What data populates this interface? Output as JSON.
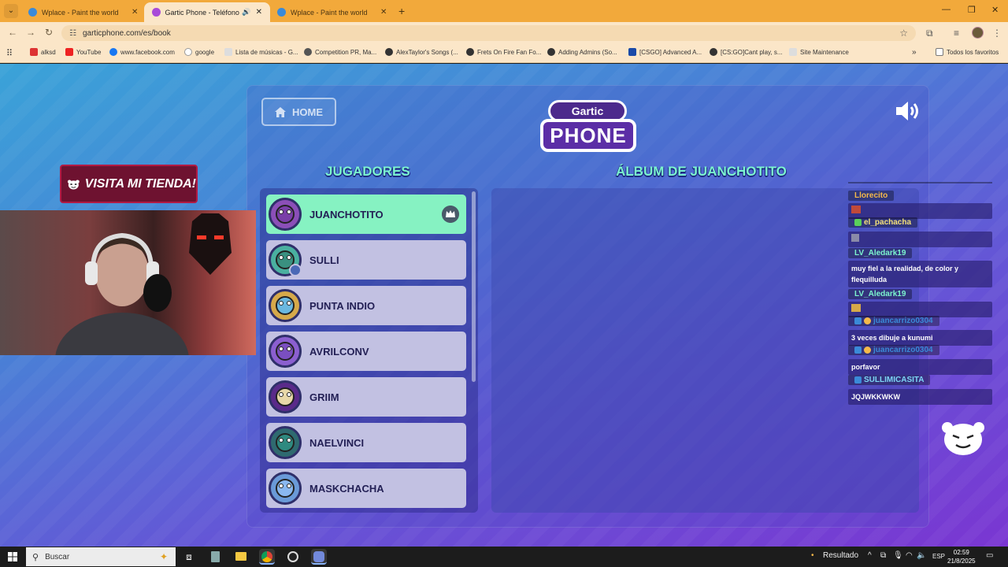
{
  "browser": {
    "tabs": [
      {
        "title": "Wplace - Paint the world",
        "active": false
      },
      {
        "title": "Gartic Phone - Teléfono Del",
        "active": true
      },
      {
        "title": "Wplace - Paint the world",
        "active": false
      }
    ],
    "url": "garticphone.com/es/book",
    "bookmarks": [
      "alksd",
      "YouTube",
      "www.facebook.com",
      "google",
      "Lista de músicas - G...",
      "Competition PR, Ma...",
      "AlexTaylor's Songs (...",
      "Frets On Fire Fan Fo...",
      "Adding Admins (So...",
      "[CSGO] Advanced A...",
      "[CS:GO]Cant play, s...",
      "Site Maintenance"
    ],
    "all_bookmarks": "Todos los favoritos"
  },
  "game": {
    "home_label": "HOME",
    "logo_top": "Gartic",
    "logo_bottom": "PHONE",
    "players_title": "JUGADORES",
    "album_title": "ÁLBUM DE JUANCHOTITO",
    "players": [
      {
        "name": "JUANCHOTITO",
        "host": true,
        "color": "#8b4fb8"
      },
      {
        "name": "SULLI",
        "host": false,
        "color": "#4ab0a0"
      },
      {
        "name": "PUNTA INDIO",
        "host": false,
        "color": "#d6a94a"
      },
      {
        "name": "AVRILCONV",
        "host": false,
        "color": "#8b5fd0"
      },
      {
        "name": "GRIIM",
        "host": false,
        "color": "#c9a050"
      },
      {
        "name": "NAELVINCI",
        "host": false,
        "color": "#2f8a80"
      },
      {
        "name": "MASKCHACHA",
        "host": false,
        "color": "#6a9ad8"
      }
    ]
  },
  "overlay": {
    "shop_text": "VISITA MI TIENDA!",
    "chat": [
      {
        "user": "Llorecito",
        "color": "#f5b94a",
        "text": ""
      },
      {
        "user": "el_pachacha",
        "color": "#f5e27a",
        "text": ""
      },
      {
        "user": "LV_Aledark19",
        "color": "#7cf5cf",
        "text": "muy fiel a la realidad, de color y flequilluda"
      },
      {
        "user": "LV_Aledark19",
        "color": "#7cf5cf",
        "text": ""
      },
      {
        "user": "juancarrizo0304",
        "color": "#3a8ad8",
        "text": "3 veces dibuje a kunumi"
      },
      {
        "user": "juancarrizo0304",
        "color": "#3a8ad8",
        "text": "porfavor"
      },
      {
        "user": "SULLIMICASITA",
        "color": "#7cd6f5",
        "text": "JQJWKKWKW"
      }
    ]
  },
  "taskbar": {
    "search_placeholder": "Buscar",
    "result_label": "Resultado",
    "lang": "ESP",
    "time": "02:59",
    "date": "21/8/2025"
  }
}
